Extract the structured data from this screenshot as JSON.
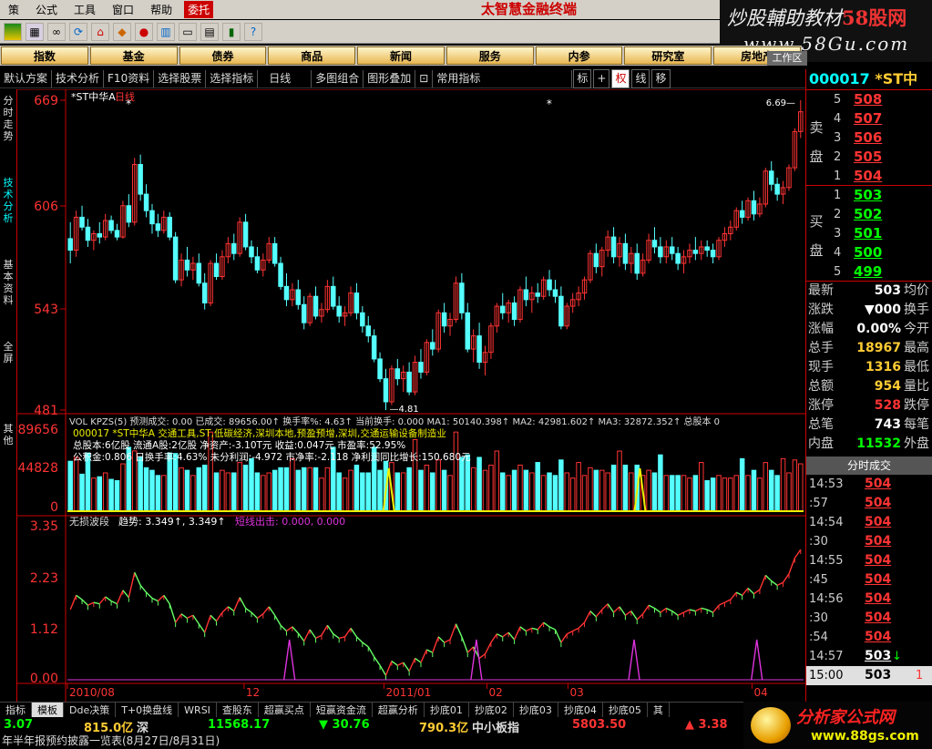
{
  "menu": {
    "items": [
      "策",
      "公式",
      "工具",
      "窗口",
      "帮助"
    ],
    "hot": "委托",
    "brand": "太智慧金融终端"
  },
  "watermark": {
    "line1_prefix": "炒股輔助教材",
    "line1_highlight": "58股网",
    "line2": "www.58Gu.com"
  },
  "toolbar_icons": [
    "flag-icon",
    "tile-icon",
    "binoculars-icon",
    "refresh-icon",
    "home-icon",
    "diamond-icon",
    "f10-icon",
    "portfolio-icon",
    "window-icon",
    "chart-icon",
    "help-icon"
  ],
  "navbar": [
    "指数",
    "基金",
    "债券",
    "商品",
    "新闻",
    "服务",
    "内参",
    "研究室",
    "房地产"
  ],
  "work_area": "工作区",
  "toolrow": [
    "默认方案",
    "技术分析",
    "F10资料",
    "选择股票",
    "选择指标",
    "日线",
    "多图组合",
    "图形叠加",
    "常用指标"
  ],
  "toolrow_btns": [
    "标",
    "+",
    "权",
    "线",
    "移"
  ],
  "left_tabs": [
    "分时走势",
    "技术分析",
    "基本资料",
    "全屏",
    "其他"
  ],
  "main_chart": {
    "title": "*ST中华A",
    "period": "日线",
    "y_labels": [
      "669",
      "606",
      "543",
      "481"
    ],
    "high_label": "6.69",
    "low_label": "4.81"
  },
  "vol_panel": {
    "header": "VOL KPZS(5) 预测成交: 0.00  已成交: 89656.00↑  换手率%: 4.63↑  当前换手: 0.000  MA1: 50140.398↑  MA2: 42981.602↑  MA3: 32872.352↑  总股本 0",
    "y_labels": [
      "89656",
      "44828",
      "0"
    ],
    "info1": "000017 *ST中华A 交通工具,ST,低碳经济,深圳本地,预盈预增,深圳,交通运输设备制造业",
    "info2": "总股本:6亿股 流通A股:2亿股 净资产:-3.10T元 收益:0.047元 市盈率:52.95%",
    "info3": "公积金:0.806 日换手率:4.63% 未分利润:-4.972 市净率:-2.118 净利润同比增长:150.680元"
  },
  "ind_panel": {
    "header_name": "无损波段",
    "header_trend": "趋势: 3.349↑, 3.349↑",
    "header_exit": "短线出击: 0.000, 0.000",
    "y_labels": [
      "3.35",
      "2.23",
      "1.12",
      "0.00"
    ]
  },
  "x_labels": [
    {
      "label": "2010/08",
      "frac": 0.0
    },
    {
      "label": "12",
      "frac": 0.24
    },
    {
      "label": "2011/01",
      "frac": 0.43
    },
    {
      "label": "02",
      "frac": 0.57
    },
    {
      "label": "03",
      "frac": 0.68
    },
    {
      "label": "04",
      "frac": 0.93
    }
  ],
  "period_tab": "日线",
  "right": {
    "code": "000017",
    "name": "*ST中",
    "sell_label": [
      "卖",
      "盘"
    ],
    "buy_label": [
      "买",
      "盘"
    ],
    "sell": [
      {
        "n": "5",
        "p": "508"
      },
      {
        "n": "4",
        "p": "507"
      },
      {
        "n": "3",
        "p": "506"
      },
      {
        "n": "2",
        "p": "505"
      },
      {
        "n": "1",
        "p": "504"
      }
    ],
    "buy": [
      {
        "n": "1",
        "p": "503"
      },
      {
        "n": "2",
        "p": "502"
      },
      {
        "n": "3",
        "p": "501"
      },
      {
        "n": "4",
        "p": "500"
      },
      {
        "n": "5",
        "p": "499"
      }
    ],
    "stats": [
      {
        "k": "最新",
        "v": "503",
        "c": "#fff",
        "k2": "均价"
      },
      {
        "k": "涨跌",
        "v": "▼000",
        "c": "#fff",
        "k2": "换手"
      },
      {
        "k": "涨幅",
        "v": "0.00%",
        "c": "#fff",
        "k2": "今开"
      },
      {
        "k": "总手",
        "v": "18967",
        "c": "#fc3",
        "k2": "最高"
      },
      {
        "k": "现手",
        "v": "1316",
        "c": "#fc3",
        "k2": "最低"
      },
      {
        "k": "总额",
        "v": "954",
        "c": "#fc3",
        "k2": "量比"
      },
      {
        "k": "涨停",
        "v": "528",
        "c": "#f33",
        "k2": "跌停"
      },
      {
        "k": "总笔",
        "v": "743",
        "c": "#fff",
        "k2": "每笔"
      },
      {
        "k": "内盘",
        "v": "11532",
        "c": "#0f0",
        "k2": "外盘"
      }
    ],
    "tick_header": "分时成交",
    "ticks": [
      {
        "t": "14:53",
        "p": "504"
      },
      {
        "t": ":57",
        "p": "504"
      },
      {
        "t": "14:54",
        "p": "504"
      },
      {
        "t": ":30",
        "p": "504"
      },
      {
        "t": "14:55",
        "p": "504"
      },
      {
        "t": ":45",
        "p": "504"
      },
      {
        "t": "14:56",
        "p": "504"
      },
      {
        "t": ":30",
        "p": "504"
      },
      {
        "t": ":54",
        "p": "504"
      },
      {
        "t": "14:57",
        "p": "503",
        "arrow": "↓"
      },
      {
        "t": "15:00",
        "p": "503",
        "sel": true,
        "side": "1"
      }
    ]
  },
  "bottom_tabs": [
    "指标",
    "模板",
    "Dde决策",
    "T+0换盘线",
    "WRSI",
    "查股东",
    "超赢买点",
    "短赢资金流",
    "超赢分析",
    "抄底01",
    "抄底02",
    "抄底03",
    "抄底04",
    "抄底05",
    "其"
  ],
  "status": {
    "a": "3.07",
    "b": "815.0亿",
    "c": "深",
    "d": "11568.17",
    "e": "▼ 30.76",
    "f": "790.3亿",
    "g": "中小板指",
    "h": "5803.50",
    "i": "▲ 3.38"
  },
  "ticker": "年半年报预约披露一览表(8月27日/8月31日)",
  "logo2": {
    "l1": "分析家公式网",
    "l2": "www.88gs.com"
  },
  "chart_data": {
    "type": "candlestick",
    "title": "*ST中华A 日线",
    "ylim": [
      4.81,
      6.69
    ],
    "candles": [
      [
        5.85,
        5.95,
        5.7,
        5.78
      ],
      [
        5.78,
        6.02,
        5.74,
        5.98
      ],
      [
        5.98,
        6.05,
        5.9,
        5.92
      ],
      [
        5.92,
        5.97,
        5.8,
        5.84
      ],
      [
        5.84,
        5.9,
        5.78,
        5.88
      ],
      [
        5.88,
        5.95,
        5.82,
        5.86
      ],
      [
        5.86,
        6.0,
        5.84,
        5.96
      ],
      [
        5.96,
        5.99,
        5.88,
        5.9
      ],
      [
        5.9,
        5.94,
        5.84,
        5.86
      ],
      [
        5.86,
        6.08,
        5.85,
        6.05
      ],
      [
        6.05,
        6.12,
        5.92,
        5.95
      ],
      [
        5.95,
        6.34,
        5.93,
        6.3
      ],
      [
        6.3,
        6.36,
        6.08,
        6.12
      ],
      [
        6.12,
        6.18,
        5.98,
        6.02
      ],
      [
        6.02,
        6.06,
        5.88,
        5.94
      ],
      [
        5.94,
        6.0,
        5.86,
        5.9
      ],
      [
        5.9,
        6.02,
        5.88,
        5.98
      ],
      [
        5.98,
        6.01,
        5.84,
        5.86
      ],
      [
        5.86,
        5.89,
        5.58,
        5.6
      ],
      [
        5.6,
        5.76,
        5.56,
        5.72
      ],
      [
        5.72,
        5.8,
        5.62,
        5.66
      ],
      [
        5.66,
        5.74,
        5.6,
        5.7
      ],
      [
        5.7,
        5.76,
        5.56,
        5.58
      ],
      [
        5.58,
        5.64,
        5.42,
        5.46
      ],
      [
        5.46,
        5.72,
        5.44,
        5.7
      ],
      [
        5.7,
        5.76,
        5.6,
        5.62
      ],
      [
        5.62,
        5.78,
        5.6,
        5.74
      ],
      [
        5.74,
        5.86,
        5.7,
        5.82
      ],
      [
        5.82,
        5.88,
        5.72,
        5.76
      ],
      [
        5.76,
        5.98,
        5.74,
        5.95
      ],
      [
        5.95,
        6.0,
        5.78,
        5.8
      ],
      [
        5.8,
        5.84,
        5.7,
        5.74
      ],
      [
        5.74,
        5.8,
        5.64,
        5.66
      ],
      [
        5.66,
        5.76,
        5.62,
        5.72
      ],
      [
        5.72,
        5.86,
        5.7,
        5.82
      ],
      [
        5.82,
        5.86,
        5.68,
        5.7
      ],
      [
        5.7,
        5.74,
        5.54,
        5.56
      ],
      [
        5.56,
        5.64,
        5.44,
        5.48
      ],
      [
        5.48,
        5.58,
        5.44,
        5.54
      ],
      [
        5.54,
        5.6,
        5.42,
        5.45
      ],
      [
        5.45,
        5.5,
        5.3,
        5.34
      ],
      [
        5.34,
        5.52,
        5.32,
        5.5
      ],
      [
        5.5,
        5.56,
        5.36,
        5.38
      ],
      [
        5.38,
        5.46,
        5.34,
        5.42
      ],
      [
        5.42,
        5.6,
        5.4,
        5.56
      ],
      [
        5.56,
        5.62,
        5.42,
        5.44
      ],
      [
        5.44,
        5.5,
        5.34,
        5.38
      ],
      [
        5.38,
        5.44,
        5.32,
        5.4
      ],
      [
        5.4,
        5.56,
        5.38,
        5.52
      ],
      [
        5.52,
        5.58,
        5.36,
        5.4
      ],
      [
        5.4,
        5.44,
        5.28,
        5.32
      ],
      [
        5.32,
        5.38,
        5.22,
        5.26
      ],
      [
        5.26,
        5.3,
        5.1,
        5.12
      ],
      [
        5.12,
        5.16,
        4.98,
        5.0
      ],
      [
        5.0,
        5.06,
        4.81,
        4.86
      ],
      [
        4.86,
        5.08,
        4.84,
        5.06
      ],
      [
        5.06,
        5.12,
        4.96,
        5.0
      ],
      [
        5.0,
        5.08,
        4.92,
        5.04
      ],
      [
        5.04,
        5.1,
        4.9,
        4.92
      ],
      [
        4.92,
        5.14,
        4.9,
        5.1
      ],
      [
        5.1,
        5.18,
        5.0,
        5.04
      ],
      [
        5.04,
        5.24,
        5.02,
        5.22
      ],
      [
        5.22,
        5.3,
        5.14,
        5.18
      ],
      [
        5.18,
        5.42,
        5.16,
        5.4
      ],
      [
        5.4,
        5.46,
        5.28,
        5.32
      ],
      [
        5.32,
        5.4,
        5.26,
        5.36
      ],
      [
        5.36,
        5.62,
        5.34,
        5.58
      ],
      [
        5.58,
        5.64,
        5.36,
        5.4
      ],
      [
        5.4,
        5.46,
        5.16,
        5.18
      ],
      [
        5.18,
        5.3,
        5.1,
        5.26
      ],
      [
        5.26,
        5.34,
        5.06,
        5.1
      ],
      [
        5.1,
        5.2,
        5.02,
        5.16
      ],
      [
        5.16,
        5.34,
        5.12,
        5.32
      ],
      [
        5.32,
        5.46,
        5.28,
        5.44
      ],
      [
        5.44,
        5.52,
        5.36,
        5.4
      ],
      [
        5.4,
        5.48,
        5.34,
        5.46
      ],
      [
        5.46,
        5.5,
        5.32,
        5.36
      ],
      [
        5.36,
        5.56,
        5.34,
        5.54
      ],
      [
        5.54,
        5.62,
        5.44,
        5.48
      ],
      [
        5.48,
        5.56,
        5.4,
        5.52
      ],
      [
        5.52,
        5.58,
        5.46,
        5.5
      ],
      [
        5.5,
        5.62,
        5.48,
        5.6
      ],
      [
        5.6,
        5.66,
        5.5,
        5.54
      ],
      [
        5.54,
        5.6,
        5.46,
        5.5
      ],
      [
        5.5,
        5.56,
        5.3,
        5.32
      ],
      [
        5.32,
        5.46,
        5.3,
        5.44
      ],
      [
        5.44,
        5.52,
        5.4,
        5.48
      ],
      [
        5.48,
        5.56,
        5.44,
        5.52
      ],
      [
        5.52,
        5.62,
        5.48,
        5.6
      ],
      [
        5.6,
        5.78,
        5.58,
        5.76
      ],
      [
        5.76,
        5.82,
        5.64,
        5.68
      ],
      [
        5.68,
        5.8,
        5.62,
        5.78
      ],
      [
        5.78,
        5.9,
        5.74,
        5.86
      ],
      [
        5.86,
        5.92,
        5.7,
        5.74
      ],
      [
        5.74,
        5.86,
        5.68,
        5.82
      ],
      [
        5.82,
        5.88,
        5.66,
        5.7
      ],
      [
        5.7,
        5.8,
        5.64,
        5.76
      ],
      [
        5.76,
        5.82,
        5.6,
        5.64
      ],
      [
        5.64,
        5.76,
        5.62,
        5.72
      ],
      [
        5.72,
        5.88,
        5.7,
        5.84
      ],
      [
        5.84,
        5.92,
        5.76,
        5.8
      ],
      [
        5.8,
        5.86,
        5.7,
        5.74
      ],
      [
        5.74,
        5.84,
        5.7,
        5.8
      ],
      [
        5.8,
        5.86,
        5.72,
        5.76
      ],
      [
        5.76,
        5.8,
        5.66,
        5.7
      ],
      [
        5.7,
        5.78,
        5.64,
        5.74
      ],
      [
        5.74,
        5.82,
        5.7,
        5.78
      ],
      [
        5.78,
        5.86,
        5.72,
        5.76
      ],
      [
        5.76,
        5.84,
        5.72,
        5.8
      ],
      [
        5.8,
        5.84,
        5.74,
        5.78
      ],
      [
        5.78,
        5.82,
        5.7,
        5.74
      ],
      [
        5.74,
        5.86,
        5.72,
        5.84
      ],
      [
        5.84,
        5.92,
        5.8,
        5.88
      ],
      [
        5.88,
        5.96,
        5.84,
        5.92
      ],
      [
        5.92,
        6.04,
        5.9,
        6.02
      ],
      [
        6.02,
        6.08,
        5.94,
        5.98
      ],
      [
        5.98,
        6.1,
        5.96,
        6.08
      ],
      [
        6.08,
        6.14,
        5.96,
        6.0
      ],
      [
        6.0,
        6.1,
        5.98,
        6.06
      ],
      [
        6.06,
        6.28,
        6.04,
        6.26
      ],
      [
        6.26,
        6.32,
        6.14,
        6.18
      ],
      [
        6.18,
        6.22,
        6.08,
        6.12
      ],
      [
        6.12,
        6.2,
        6.06,
        6.16
      ],
      [
        6.16,
        6.3,
        6.14,
        6.28
      ],
      [
        6.28,
        6.52,
        6.26,
        6.5
      ],
      [
        6.5,
        6.69,
        6.46,
        6.62
      ]
    ]
  }
}
